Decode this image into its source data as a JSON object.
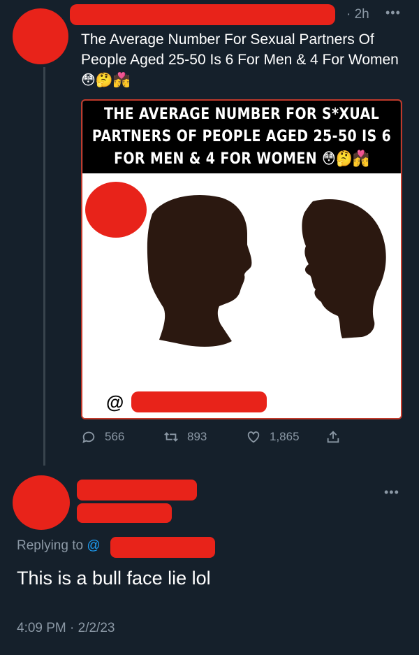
{
  "tweet": {
    "time": "· 2h",
    "more_icon": "more-dots-icon",
    "text": "The Average Number For Sexual Partners Of People Aged 25-50 Is 6 For Men & 4 For Women",
    "text_emojis": "😳🤔💏",
    "image": {
      "headline": "THE AVERAGE NUMBER FOR S*XUAL PARTNERS OF PEOPLE AGED 25-50 IS 6 FOR MEN & 4 FOR WOMEN",
      "headline_emojis": "😳🤔💏",
      "at_symbol": "@"
    },
    "actions": {
      "replies": "566",
      "retweets": "893",
      "likes": "1,865"
    }
  },
  "reply": {
    "replying_label": "Replying to",
    "replying_at": "@",
    "text": "This is a bull face lie lol",
    "timestamp": "4:09 PM · 2/2/23"
  },
  "colors": {
    "background": "#15202b",
    "muted": "#8b98a5",
    "link": "#1d9bf0",
    "redaction": "#e8231a"
  }
}
